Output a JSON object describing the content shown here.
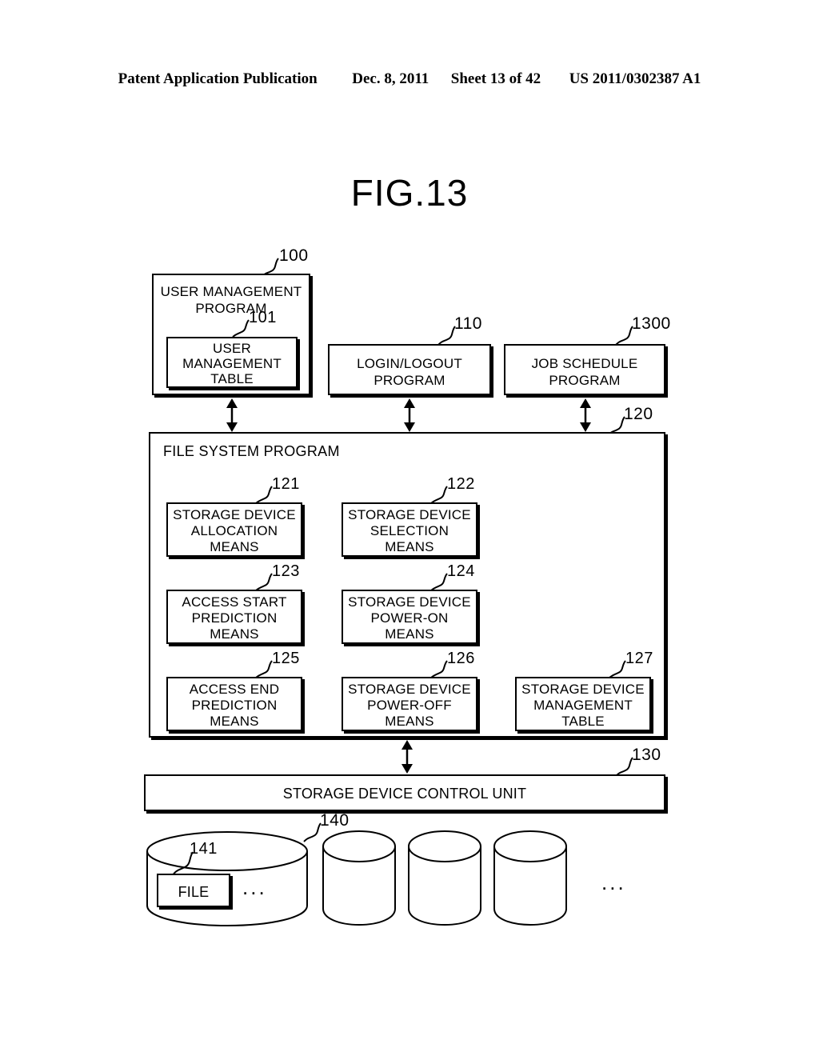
{
  "header": {
    "publication": "Patent Application Publication",
    "date": "Dec. 8, 2011",
    "sheet": "Sheet 13 of 42",
    "number": "US 2011/0302387 A1"
  },
  "figure": {
    "title": "FIG.13"
  },
  "diagram": {
    "user_management_program": {
      "ref": "100",
      "label": "USER MANAGEMENT PROGRAM",
      "line1": "USER MANAGEMENT",
      "line2": "PROGRAM"
    },
    "user_management_table": {
      "ref": "101",
      "line1": "USER",
      "line2": "MANAGEMENT",
      "line3": "TABLE"
    },
    "login_logout_program": {
      "ref": "110",
      "line1": "LOGIN/LOGOUT",
      "line2": "PROGRAM"
    },
    "job_schedule_program": {
      "ref": "1300",
      "line1": "JOB SCHEDULE",
      "line2": "PROGRAM"
    },
    "file_system_program": {
      "ref": "120",
      "label": "FILE SYSTEM PROGRAM"
    },
    "means": [
      {
        "ref": "121",
        "name": "storage-device-allocation-means",
        "line1": "STORAGE DEVICE",
        "line2": "ALLOCATION",
        "line3": "MEANS"
      },
      {
        "ref": "122",
        "name": "storage-device-selection-means",
        "line1": "STORAGE DEVICE",
        "line2": "SELECTION",
        "line3": "MEANS"
      },
      {
        "ref": "123",
        "name": "access-start-prediction-means",
        "line1": "ACCESS START",
        "line2": "PREDICTION",
        "line3": "MEANS"
      },
      {
        "ref": "124",
        "name": "storage-device-power-on-means",
        "line1": "STORAGE DEVICE",
        "line2": "POWER-ON",
        "line3": "MEANS"
      },
      {
        "ref": "125",
        "name": "access-end-prediction-means",
        "line1": "ACCESS END",
        "line2": "PREDICTION",
        "line3": "MEANS"
      },
      {
        "ref": "126",
        "name": "storage-device-power-off-means",
        "line1": "STORAGE DEVICE",
        "line2": "POWER-OFF",
        "line3": "MEANS"
      },
      {
        "ref": "127",
        "name": "storage-device-management-table",
        "line1": "STORAGE DEVICE",
        "line2": "MANAGEMENT",
        "line3": "TABLE"
      }
    ],
    "storage_device_control_unit": {
      "ref": "130",
      "label": "STORAGE DEVICE CONTROL UNIT"
    },
    "storage_device": {
      "ref": "140"
    },
    "file": {
      "ref": "141",
      "label": "FILE"
    },
    "ellipsis_in_device": "...",
    "ellipsis_after_devices": "..."
  },
  "colors": {
    "ink": "#000000",
    "paper": "#ffffff"
  }
}
